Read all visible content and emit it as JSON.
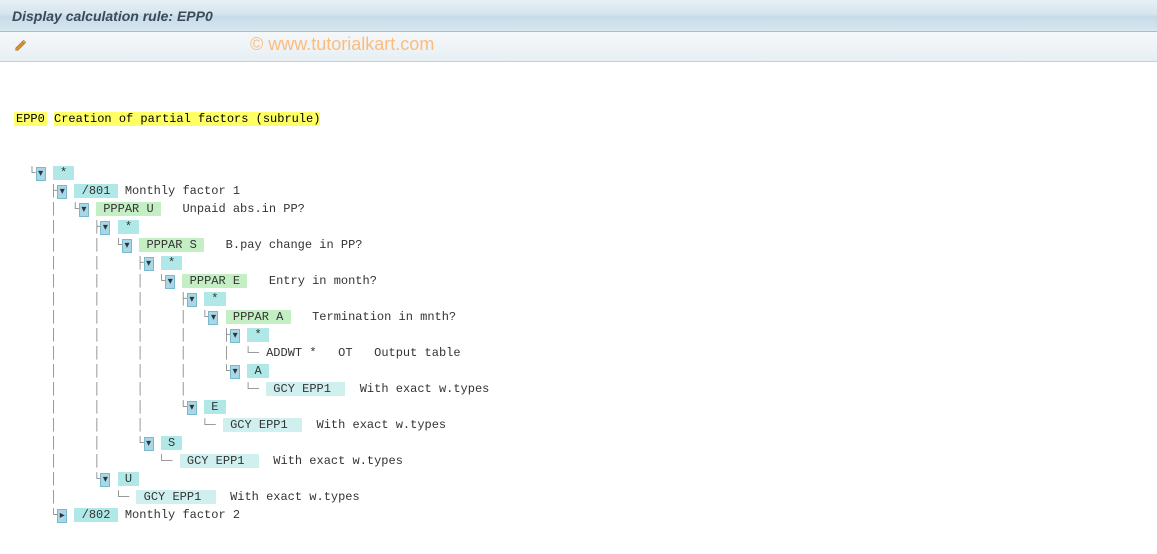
{
  "title": "Display calculation rule: EPP0",
  "watermark": "© www.tutorialkart.com",
  "root": {
    "code": "EPP0",
    "desc": "Creation of partial factors (subrule)"
  },
  "tree": [
    {
      "indent": 0,
      "expander": "open",
      "token1": "*",
      "style1": "cyan"
    },
    {
      "indent": 1,
      "expander": "open",
      "token1": "/801",
      "style1": "cyan",
      "desc": "Monthly factor 1"
    },
    {
      "indent": 2,
      "expander": "open",
      "token1": "PPPAR U",
      "style1": "green",
      "desc": "Unpaid abs.in PP?",
      "descGap": "   "
    },
    {
      "indent": 3,
      "expander": "open",
      "token1": "*",
      "style1": "cyan"
    },
    {
      "indent": 4,
      "expander": "open",
      "token1": "PPPAR S",
      "style1": "green",
      "desc": "B.pay change in PP?",
      "descGap": "   "
    },
    {
      "indent": 5,
      "expander": "open",
      "token1": "*",
      "style1": "cyan"
    },
    {
      "indent": 6,
      "expander": "open",
      "token1": "PPPAR E",
      "style1": "green",
      "desc": "Entry in month?",
      "descGap": "   "
    },
    {
      "indent": 7,
      "expander": "open",
      "token1": "*",
      "style1": "cyan"
    },
    {
      "indent": 8,
      "expander": "open",
      "token1": "PPPAR A",
      "style1": "green",
      "desc": "Termination in mnth?",
      "descGap": "   "
    },
    {
      "indent": 9,
      "expander": "open",
      "token1": "*",
      "style1": "cyan"
    },
    {
      "indent": 10,
      "expander": "none",
      "token1": "ADDWT *  ",
      "style1": "none",
      "token2": "OT",
      "desc": "Output table",
      "descGap": "   "
    },
    {
      "indent": 9,
      "expander": "open",
      "token1": "A",
      "style1": "cyan"
    },
    {
      "indent": 10,
      "expander": "none",
      "token1": "GCY EPP1 ",
      "style1": "lightcyan",
      "desc": "With exact w.types",
      "descGap": "  "
    },
    {
      "indent": 7,
      "expander": "open",
      "token1": "E",
      "style1": "cyan"
    },
    {
      "indent": 8,
      "expander": "none",
      "token1": "GCY EPP1 ",
      "style1": "lightcyan",
      "desc": "With exact w.types",
      "descGap": "  "
    },
    {
      "indent": 5,
      "expander": "open",
      "token1": "S",
      "style1": "cyan"
    },
    {
      "indent": 6,
      "expander": "none",
      "token1": "GCY EPP1 ",
      "style1": "lightcyan",
      "desc": "With exact w.types",
      "descGap": "  "
    },
    {
      "indent": 3,
      "expander": "open",
      "token1": "U",
      "style1": "cyan"
    },
    {
      "indent": 4,
      "expander": "none",
      "token1": "GCY EPP1 ",
      "style1": "lightcyan",
      "desc": "With exact w.types",
      "descGap": "  "
    },
    {
      "indent": 1,
      "expander": "closed",
      "token1": "/802",
      "style1": "cyan",
      "desc": "Monthly factor 2"
    }
  ]
}
